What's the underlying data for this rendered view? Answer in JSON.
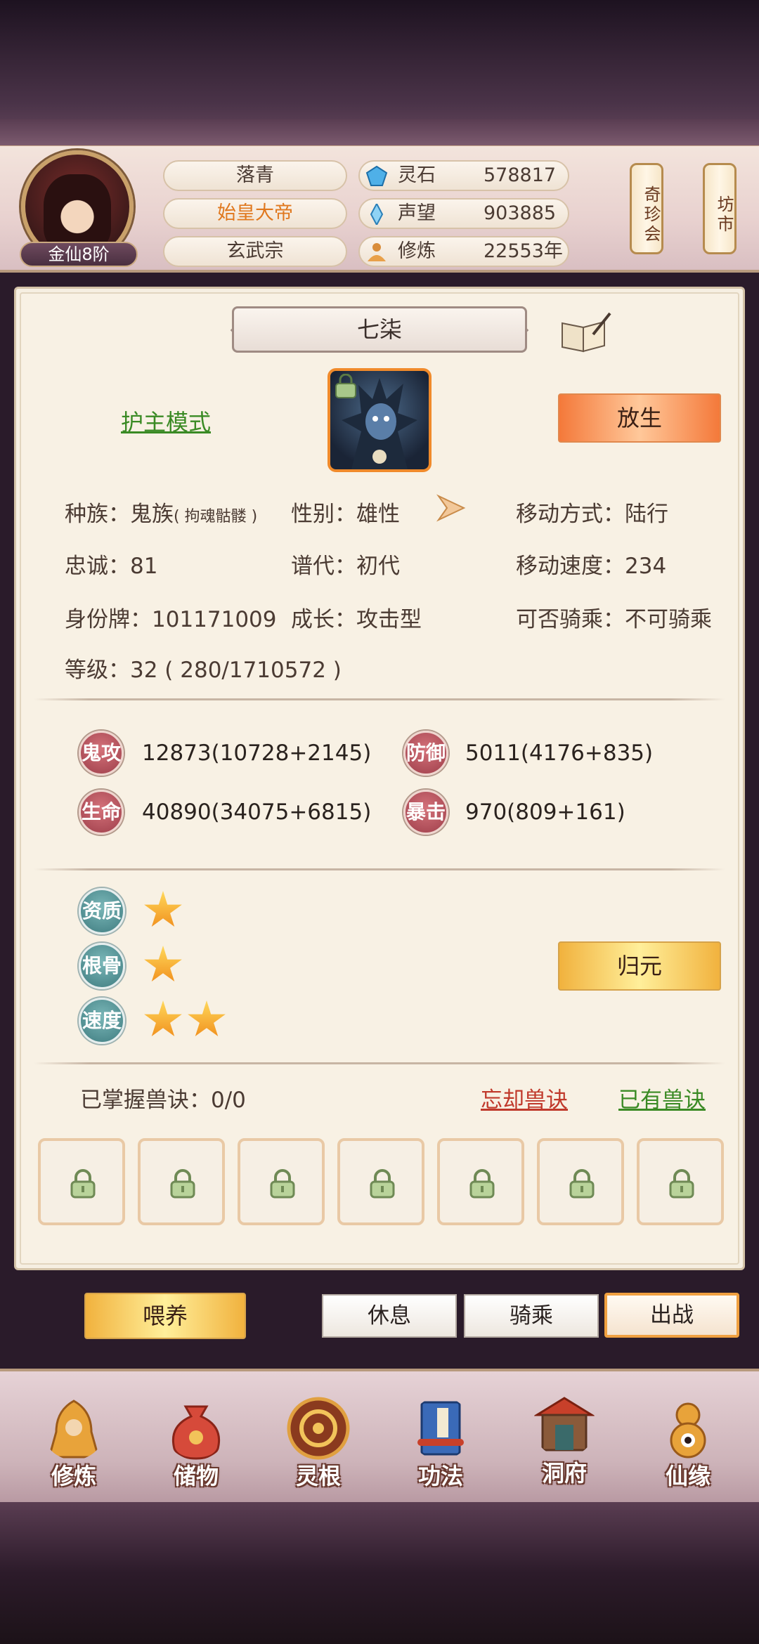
{
  "header": {
    "rank": "金仙8阶",
    "name": "落青",
    "title": "始皇大帝",
    "sect": "玄武宗",
    "stats": [
      {
        "label": "灵石",
        "value": "578817",
        "icon": "spirit-stone-icon"
      },
      {
        "label": "声望",
        "value": "903885",
        "icon": "prestige-crystal-icon"
      },
      {
        "label": "修炼",
        "value": "22553年",
        "icon": "meditation-icon"
      }
    ],
    "side_tabs": [
      "奇珍会",
      "坊市"
    ]
  },
  "pet": {
    "name": "七柒",
    "mode_link": "护主模式",
    "release_button": "放生",
    "attributes": {
      "race_label": "种族：",
      "race_value": "鬼族",
      "race_sub": "( 拘魂骷髅 )",
      "gender": "性别：雄性",
      "move_type": "移动方式：陆行",
      "loyalty": "忠诚：81",
      "generation": "谱代：初代",
      "move_speed": "移动速度：234",
      "id_tag": "身份牌：101171009",
      "growth": "成长：攻击型",
      "rideable": "可否骑乘：不可骑乘",
      "level": "等级：32 ( 280/1710572 )"
    },
    "combat": [
      {
        "badge": "鬼攻",
        "value": "12873(10728+2145)"
      },
      {
        "badge": "防御",
        "value": "5011(4176+835)"
      },
      {
        "badge": "生命",
        "value": "40890(34075+6815)"
      },
      {
        "badge": "暴击",
        "value": "970(809+161)"
      }
    ],
    "qualities": [
      {
        "badge": "资质",
        "stars": 1
      },
      {
        "badge": "根骨",
        "stars": 1
      },
      {
        "badge": "速度",
        "stars": 2
      }
    ],
    "return_button": "归元",
    "skills_label": "已掌握兽诀：0/0",
    "forget_link": "忘却兽诀",
    "owned_link": "已有兽诀",
    "slot_count": 7
  },
  "actions": {
    "feed": "喂养",
    "rest": "休息",
    "ride": "骑乘",
    "sortie": "出战"
  },
  "nav": [
    {
      "label": "修炼",
      "icon": "cultivation-monk-icon"
    },
    {
      "label": "储物",
      "icon": "storage-bag-icon"
    },
    {
      "label": "灵根",
      "icon": "spirit-root-icon"
    },
    {
      "label": "功法",
      "icon": "technique-book-icon"
    },
    {
      "label": "洞府",
      "icon": "cave-mansion-icon"
    },
    {
      "label": "仙缘",
      "icon": "immortal-fate-gourd-icon"
    }
  ],
  "colors": {
    "link_green": "#3a8a24",
    "link_red": "#c0392b",
    "accent_orange": "#f08a2b"
  }
}
